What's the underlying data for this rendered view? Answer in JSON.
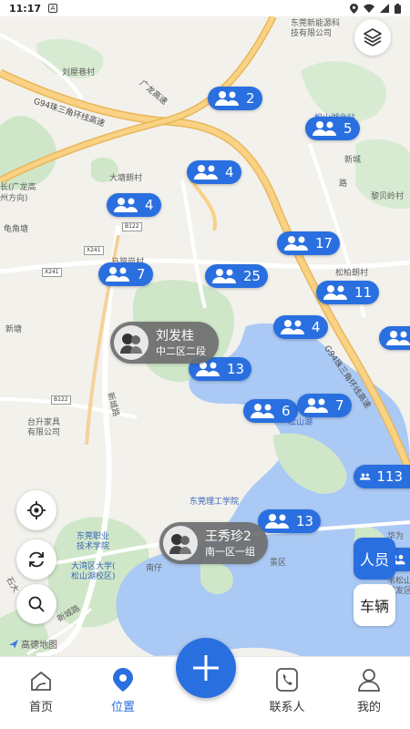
{
  "status_bar": {
    "time": "11:17",
    "notification_icon": "A"
  },
  "map": {
    "labels": {
      "dongguan_energy": "东莞新能源科",
      "dongguan_energy_2": "技有限公司",
      "liuwu": "刘屋巷村",
      "guanglong": "广龙高速",
      "g94": "G94珠三角环线高速",
      "xincheng_top": "新城",
      "xincheng_top2": "路",
      "songshan_station": "松山湖北站",
      "datang": "大塘朗村",
      "guanglong_left": "长(广龙高",
      "guanglong_left2": "州方向)",
      "guijiao": "龟角塘",
      "xintang": "新塘",
      "liubei": "黎贝岭村",
      "songbai": "松柏朗村",
      "mayong": "马蹄岗村",
      "xinchenglu_mid": "新城路",
      "g94_right": "G94珠三角环线高速",
      "taisheng": "台升家具",
      "taisheng2": "有限公司",
      "songshan_lake": "松山湖",
      "dongguan_tech": "东莞理工学院",
      "dongguan_vocational": "东莞职业",
      "dongguan_vocational2": "技术学院",
      "dawan": "大湾区大学(",
      "dawan2": "松山湖校区)",
      "xincheng_bottom": "新城路",
      "jingjiang": "景区",
      "huazai": "南仔",
      "shitong": "石大",
      "huawei": "华为",
      "shanshan": "苇松山湖",
      "research": "研发区",
      "road_b122_a": "B122",
      "road_x241_a": "X241",
      "road_x241_b": "X241",
      "road_b122_b": "B122"
    },
    "clusters": [
      {
        "count": "2"
      },
      {
        "count": "5"
      },
      {
        "count": "4"
      },
      {
        "count": "4"
      },
      {
        "count": "17"
      },
      {
        "count": "7"
      },
      {
        "count": "25"
      },
      {
        "count": "11"
      },
      {
        "count": "4"
      },
      {
        "count": ""
      },
      {
        "count": "13"
      },
      {
        "count": "6"
      },
      {
        "count": "7"
      },
      {
        "count": "113"
      },
      {
        "count": "13"
      },
      {
        "count": ""
      }
    ],
    "people": [
      {
        "name": "刘发桂",
        "group": "中二区二段"
      },
      {
        "name": "王秀珍2",
        "group": "南一区一组"
      }
    ],
    "controls": {
      "layers_icon": "layers-icon",
      "locate_icon": "locate-icon",
      "refresh_icon": "refresh-icon",
      "search_icon": "search-icon"
    },
    "toggles": {
      "people": "人员",
      "vehicles": "车辆"
    },
    "attribution": "高德地图"
  },
  "bottom_nav": {
    "items": [
      {
        "label": "首页",
        "icon": "home-icon"
      },
      {
        "label": "位置",
        "icon": "location-pin-icon"
      },
      {
        "label": "联系人",
        "icon": "phone-icon"
      },
      {
        "label": "我的",
        "icon": "user-icon"
      }
    ],
    "fab_icon": "plus-icon"
  },
  "colors": {
    "accent": "#2a6fe0",
    "highway": "#f7c56b",
    "water": "#a9c9f5",
    "green": "#cce8c9"
  }
}
